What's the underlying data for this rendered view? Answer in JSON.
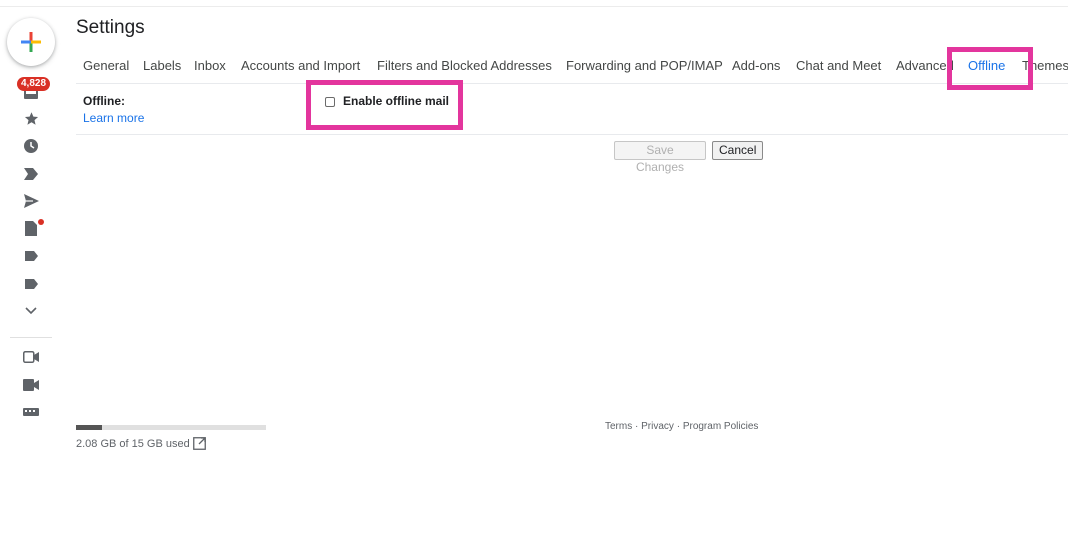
{
  "header": {
    "title": "Settings"
  },
  "rail": {
    "compose_icon": "compose-plus-icon",
    "badge": "4,828",
    "items": [
      "inbox-icon",
      "star-icon",
      "clock-icon",
      "label-arrow-icon",
      "send-icon",
      "draft-icon",
      "label-icon",
      "label-icon",
      "chevron-down-icon",
      "video-outline-icon",
      "video-icon",
      "keyboard-icon"
    ]
  },
  "tabs": [
    {
      "label": "General"
    },
    {
      "label": "Labels"
    },
    {
      "label": "Inbox"
    },
    {
      "label": "Accounts and Import"
    },
    {
      "label": "Filters and Blocked Addresses"
    },
    {
      "label": "Forwarding and POP/IMAP"
    },
    {
      "label": "Add-ons"
    },
    {
      "label": "Chat and Meet"
    },
    {
      "label": "Advanced"
    },
    {
      "label": "Offline"
    },
    {
      "label": "Themes"
    }
  ],
  "active_tab": "Offline",
  "offline": {
    "label": "Offline:",
    "learn_more": "Learn more",
    "checkbox_label": "Enable offline mail",
    "checked": false
  },
  "buttons": {
    "save": "Save Changes",
    "cancel": "Cancel"
  },
  "storage": {
    "used_text": "2.08 GB of 15 GB used",
    "used_fraction": 0.139
  },
  "footer": {
    "terms": "Terms",
    "sep": " · ",
    "privacy": "Privacy",
    "policies": "Program Policies"
  },
  "colors": {
    "accent": "#1a73e8",
    "highlight": "#e3359d",
    "badge": "#d93025"
  }
}
